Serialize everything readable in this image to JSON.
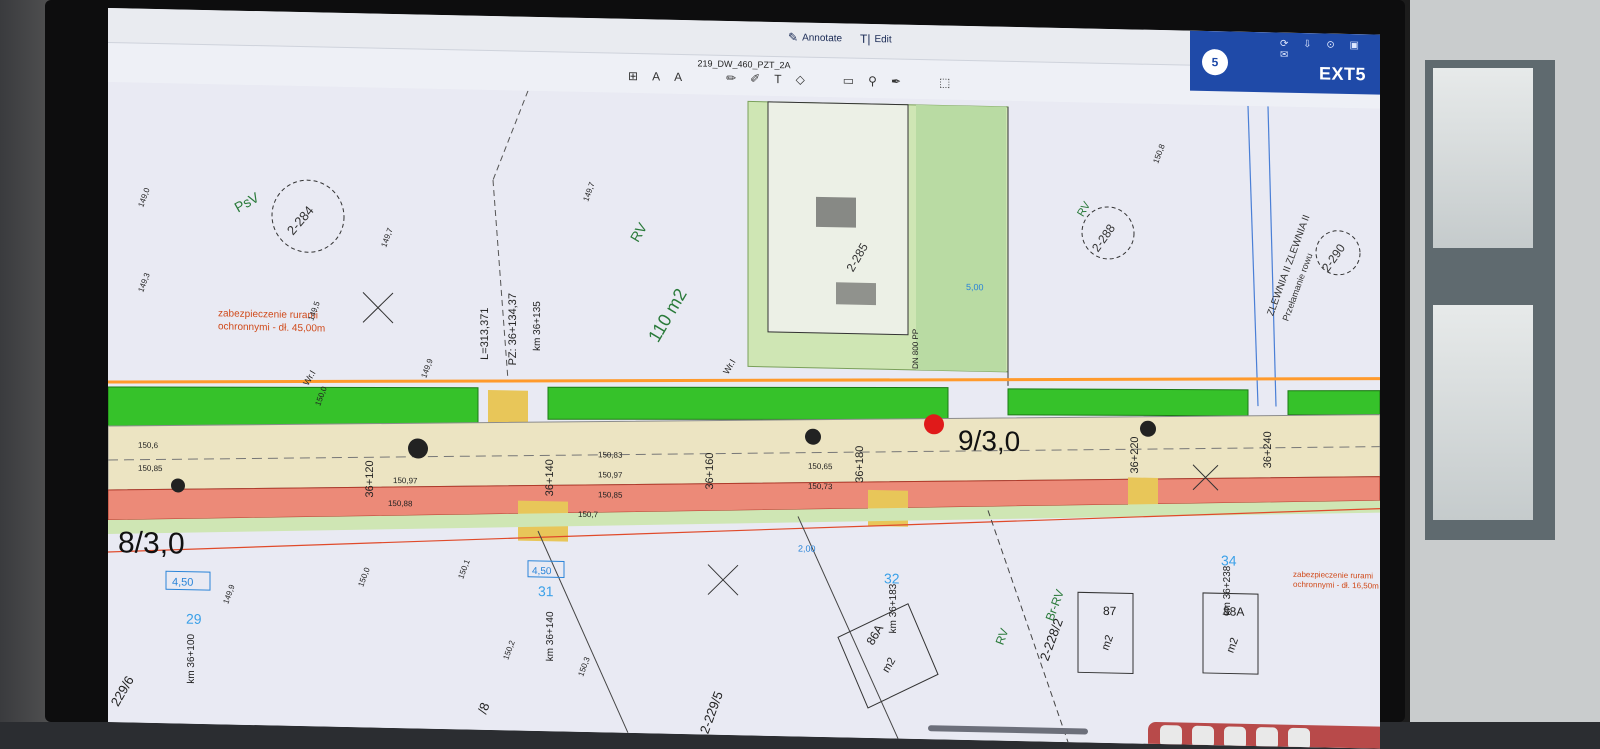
{
  "app": {
    "tabs": [
      {
        "label": "Annotate",
        "icon": "pen-icon"
      },
      {
        "label": "Edit",
        "icon": "text-cursor-icon"
      }
    ],
    "document_title": "219_DW_460_PZT_2A",
    "ext_badge": "EXT5",
    "notification_count": "5"
  },
  "toolbar": {
    "items": [
      "format-icon",
      "text-style-icon",
      "text-icon",
      "pencil-icon",
      "marker-icon",
      "type-icon",
      "shape-icon",
      "comment-icon",
      "stamp-icon",
      "signature-icon",
      "select-area-icon"
    ]
  },
  "drawing": {
    "labels": {
      "psv": "PsV",
      "parcel_2284": "2-284",
      "rv_area": "RV",
      "area_110": "110 m2",
      "parcel_2285": "2-285",
      "parcel_2288": "2-288",
      "rv_top_right": "RV",
      "parcel_2290": "2-290",
      "protection_left": "zabezpieczenie rurami",
      "protection_left_2": "ochronnymi - dł. 45,00m",
      "l_dist": "L=313,371",
      "pz": "PZ: 36+134,37",
      "km_135": "km 36+135",
      "km_120": "36+120",
      "km_140": "36+140",
      "km_160": "36+160",
      "km_180": "36+180",
      "km_220": "36+220",
      "km_240": "36+240",
      "big_left": "8/3,0",
      "big_mid": "9/3,0",
      "parcel_29": "29",
      "km_100": "km 36+100",
      "parcel_31": "31",
      "km_140b": "km 36+140",
      "parcel_32": "32",
      "km_183": "km 36+183",
      "parcel_86a": "86A",
      "m2_86a": "m2",
      "parcel_87": "87",
      "m2_87": "m2",
      "parcel_88a": "88A",
      "m2_88a": "m2",
      "parcel_34": "34",
      "km_238": "km 36+238",
      "rv_bottom": "RV",
      "br_rv": "Br-RV",
      "parcel_22282": "2-228/2",
      "parcel_2229": "2-229/5",
      "parcel_2296": "229/6",
      "parcel_18": "/8",
      "protection_right": "zabezpieczenie rurami",
      "protection_right_2": "ochronnymi - dł. 16,50m",
      "dim_450a": "4,50",
      "dim_450b": "4,50",
      "dim_200": "2,00",
      "dim_500": "5,00",
      "wr_a": "Wr.I",
      "wr_b": "Wr.I",
      "dn": "DN 800 PP",
      "zlewnia": "ZLEWNIA II ZLEWNIA II",
      "przelamanie": "Przełamanie rowu"
    },
    "elevations": [
      "149,0",
      "149,7",
      "149,3",
      "149,5",
      "149,9",
      "150,0",
      "149,7",
      "150,6",
      "150,85",
      "150,97",
      "150,88",
      "150,83",
      "150,97",
      "150,85",
      "150,65",
      "150,73",
      "150,7",
      "150,2",
      "150,3",
      "150,1",
      "149,9",
      "150,0",
      "150,8"
    ],
    "colors": {
      "green_strip": "#36c22a",
      "road": "#ece4c2",
      "red_strip": "#ec8a78",
      "orange_line": "#ff9a2b",
      "parcel_outline": "#8aa0d6",
      "building_green": "#cfe6b4",
      "blue_dim": "#2a84d8",
      "marker_red": "#e01a1a"
    }
  }
}
